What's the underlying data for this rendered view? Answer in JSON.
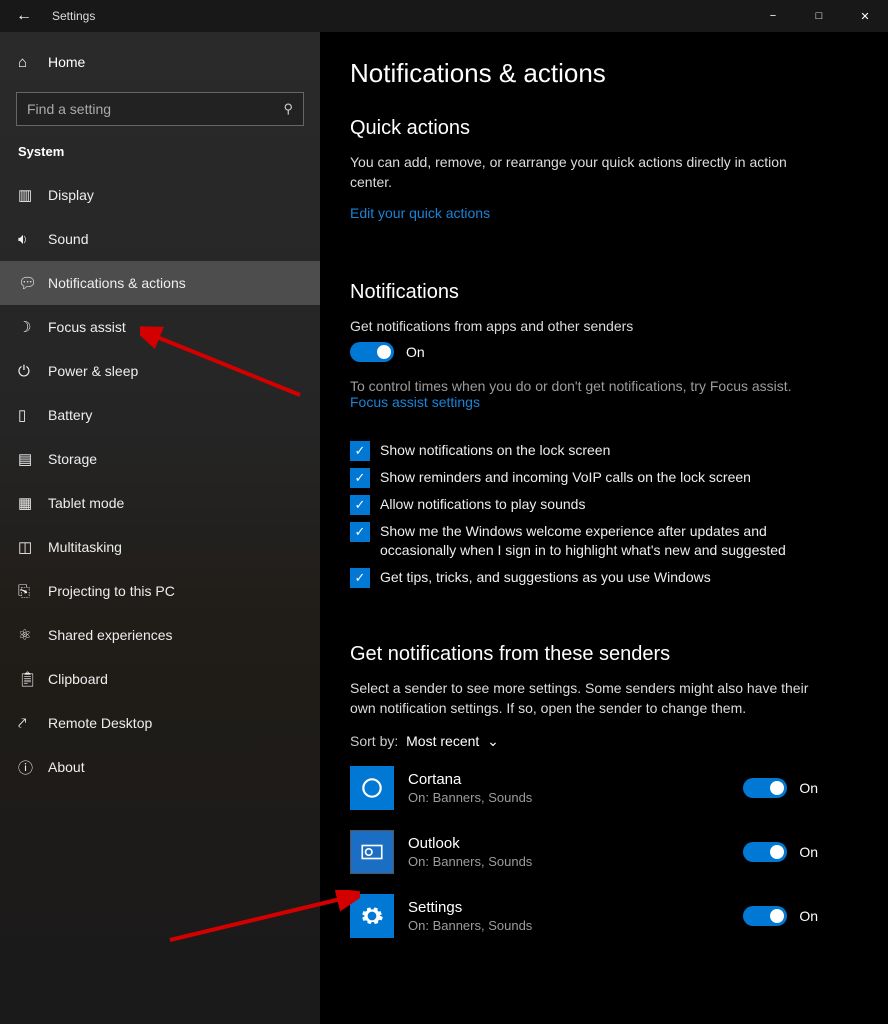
{
  "window": {
    "title": "Settings"
  },
  "sidebar": {
    "home": "Home",
    "search_placeholder": "Find a setting",
    "section": "System",
    "items": [
      {
        "icon": "display",
        "label": "Display"
      },
      {
        "icon": "sound",
        "label": "Sound"
      },
      {
        "icon": "notifications",
        "label": "Notifications & actions",
        "selected": true
      },
      {
        "icon": "focus",
        "label": "Focus assist"
      },
      {
        "icon": "power",
        "label": "Power & sleep"
      },
      {
        "icon": "battery",
        "label": "Battery"
      },
      {
        "icon": "storage",
        "label": "Storage"
      },
      {
        "icon": "tablet",
        "label": "Tablet mode"
      },
      {
        "icon": "multitask",
        "label": "Multitasking"
      },
      {
        "icon": "project",
        "label": "Projecting to this PC"
      },
      {
        "icon": "shared",
        "label": "Shared experiences"
      },
      {
        "icon": "clipboard",
        "label": "Clipboard"
      },
      {
        "icon": "remote",
        "label": "Remote Desktop"
      },
      {
        "icon": "about",
        "label": "About"
      }
    ]
  },
  "main": {
    "title": "Notifications & actions",
    "quick": {
      "heading": "Quick actions",
      "desc": "You can add, remove, or rearrange your quick actions directly in action center.",
      "link": "Edit your quick actions"
    },
    "notifications": {
      "heading": "Notifications",
      "toggle_desc": "Get notifications from apps and other senders",
      "toggle_state": "On",
      "grey_text": "To control times when you do or don't get notifications, try Focus assist.",
      "focus_link": "Focus assist settings",
      "checks": [
        "Show notifications on the lock screen",
        "Show reminders and incoming VoIP calls on the lock screen",
        "Allow notifications to play sounds",
        "Show me the Windows welcome experience after updates and occasionally when I sign in to highlight what's new and suggested",
        "Get tips, tricks, and suggestions as you use Windows"
      ]
    },
    "senders": {
      "heading": "Get notifications from these senders",
      "desc": "Select a sender to see more settings. Some senders might also have their own notification settings. If so, open the sender to change them.",
      "sort_label": "Sort by:",
      "sort_value": "Most recent",
      "items": [
        {
          "name": "Cortana",
          "sub": "On: Banners, Sounds",
          "state": "On",
          "icon": "cortana"
        },
        {
          "name": "Outlook",
          "sub": "On: Banners, Sounds",
          "state": "On",
          "icon": "outlook"
        },
        {
          "name": "Settings",
          "sub": "On: Banners, Sounds",
          "state": "On",
          "icon": "settings"
        }
      ]
    }
  }
}
